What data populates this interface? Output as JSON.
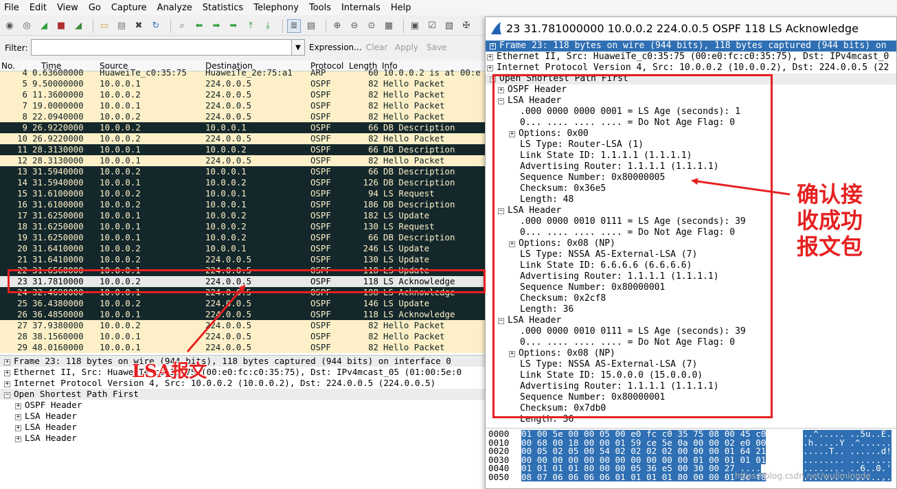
{
  "menubar": [
    "File",
    "Edit",
    "View",
    "Go",
    "Capture",
    "Analyze",
    "Statistics",
    "Telephony",
    "Tools",
    "Internals",
    "Help"
  ],
  "toolbar_icons": [
    "circle-icon",
    "record-icon",
    "shark-fin-icon",
    "stop-icon",
    "restart-icon",
    "open-icon",
    "save-icon",
    "close-icon",
    "reload-icon",
    "find-icon",
    "back-icon",
    "forward-icon",
    "goto-icon",
    "first-icon",
    "last-icon",
    "colorize-icon",
    "autoscroll-icon",
    "zoom-in-icon",
    "zoom-out-icon",
    "normal-size-icon",
    "resize-columns-icon",
    "capture-filters-icon",
    "display-filters-icon",
    "coloring-rules-icon",
    "preferences-icon"
  ],
  "filter": {
    "label": "Filter:",
    "value": "",
    "expression": "Expression...",
    "clear": "Clear",
    "apply": "Apply",
    "save": "Save"
  },
  "columns": [
    "No.",
    "Time",
    "Source",
    "Destination",
    "Protocol",
    "Length",
    "Info"
  ],
  "packets": [
    {
      "no": "4",
      "time": "0.63600000",
      "src": "HuaweiTe_c0:35:75",
      "dst": "HuaweiTe_2e:75:a1",
      "proto": "ARP",
      "len": "60",
      "info": "10.0.0.2 is at 00:e",
      "style": "hello"
    },
    {
      "no": "5",
      "time": "9.50000000",
      "src": "10.0.0.1",
      "dst": "224.0.0.5",
      "proto": "OSPF",
      "len": "82",
      "info": "Hello Packet",
      "style": "hello"
    },
    {
      "no": "6",
      "time": "11.3600000",
      "src": "10.0.0.2",
      "dst": "224.0.0.5",
      "proto": "OSPF",
      "len": "82",
      "info": "Hello Packet",
      "style": "hello"
    },
    {
      "no": "7",
      "time": "19.0000000",
      "src": "10.0.0.1",
      "dst": "224.0.0.5",
      "proto": "OSPF",
      "len": "82",
      "info": "Hello Packet",
      "style": "hello"
    },
    {
      "no": "8",
      "time": "22.0940000",
      "src": "10.0.0.2",
      "dst": "224.0.0.5",
      "proto": "OSPF",
      "len": "82",
      "info": "Hello Packet",
      "style": "hello"
    },
    {
      "no": "9",
      "time": "26.9220000",
      "src": "10.0.0.2",
      "dst": "10.0.0.1",
      "proto": "OSPF",
      "len": "66",
      "info": "DB Description",
      "style": "dark"
    },
    {
      "no": "10",
      "time": "26.9220000",
      "src": "10.0.0.2",
      "dst": "224.0.0.5",
      "proto": "OSPF",
      "len": "82",
      "info": "Hello Packet",
      "style": "hello"
    },
    {
      "no": "11",
      "time": "28.3130000",
      "src": "10.0.0.1",
      "dst": "10.0.0.2",
      "proto": "OSPF",
      "len": "66",
      "info": "DB Description",
      "style": "dark"
    },
    {
      "no": "12",
      "time": "28.3130000",
      "src": "10.0.0.1",
      "dst": "224.0.0.5",
      "proto": "OSPF",
      "len": "82",
      "info": "Hello Packet",
      "style": "hello"
    },
    {
      "no": "13",
      "time": "31.5940000",
      "src": "10.0.0.2",
      "dst": "10.0.0.1",
      "proto": "OSPF",
      "len": "66",
      "info": "DB Description",
      "style": "dark"
    },
    {
      "no": "14",
      "time": "31.5940000",
      "src": "10.0.0.1",
      "dst": "10.0.0.2",
      "proto": "OSPF",
      "len": "126",
      "info": "DB Description",
      "style": "dark"
    },
    {
      "no": "15",
      "time": "31.6100000",
      "src": "10.0.0.2",
      "dst": "10.0.0.1",
      "proto": "OSPF",
      "len": "94",
      "info": "LS Request",
      "style": "dark"
    },
    {
      "no": "16",
      "time": "31.6100000",
      "src": "10.0.0.2",
      "dst": "10.0.0.1",
      "proto": "OSPF",
      "len": "186",
      "info": "DB Description",
      "style": "dark"
    },
    {
      "no": "17",
      "time": "31.6250000",
      "src": "10.0.0.1",
      "dst": "10.0.0.2",
      "proto": "OSPF",
      "len": "182",
      "info": "LS Update",
      "style": "dark"
    },
    {
      "no": "18",
      "time": "31.6250000",
      "src": "10.0.0.1",
      "dst": "10.0.0.2",
      "proto": "OSPF",
      "len": "130",
      "info": "LS Request",
      "style": "dark"
    },
    {
      "no": "19",
      "time": "31.6250000",
      "src": "10.0.0.1",
      "dst": "10.0.0.2",
      "proto": "OSPF",
      "len": "66",
      "info": "DB Description",
      "style": "dark"
    },
    {
      "no": "20",
      "time": "31.6410000",
      "src": "10.0.0.2",
      "dst": "10.0.0.1",
      "proto": "OSPF",
      "len": "246",
      "info": "LS Update",
      "style": "dark"
    },
    {
      "no": "21",
      "time": "31.6410000",
      "src": "10.0.0.2",
      "dst": "224.0.0.5",
      "proto": "OSPF",
      "len": "130",
      "info": "LS Update",
      "style": "dark"
    },
    {
      "no": "22",
      "time": "31.6560000",
      "src": "10.0.0.1",
      "dst": "224.0.0.5",
      "proto": "OSPF",
      "len": "118",
      "info": "LS Update",
      "style": "dark"
    },
    {
      "no": "23",
      "time": "31.7810000",
      "src": "10.0.0.2",
      "dst": "224.0.0.5",
      "proto": "OSPF",
      "len": "118",
      "info": "LS Acknowledge",
      "style": "sel"
    },
    {
      "no": "24",
      "time": "32.4690000",
      "src": "10.0.0.1",
      "dst": "224.0.0.5",
      "proto": "OSPF",
      "len": "198",
      "info": "LS Acknowledge",
      "style": "dark"
    },
    {
      "no": "25",
      "time": "36.4380000",
      "src": "10.0.0.2",
      "dst": "224.0.0.5",
      "proto": "OSPF",
      "len": "146",
      "info": "LS Update",
      "style": "dark"
    },
    {
      "no": "26",
      "time": "36.4850000",
      "src": "10.0.0.1",
      "dst": "224.0.0.5",
      "proto": "OSPF",
      "len": "118",
      "info": "LS Acknowledge",
      "style": "dark"
    },
    {
      "no": "27",
      "time": "37.9380000",
      "src": "10.0.0.2",
      "dst": "224.0.0.5",
      "proto": "OSPF",
      "len": "82",
      "info": "Hello Packet",
      "style": "hello"
    },
    {
      "no": "28",
      "time": "38.1560000",
      "src": "10.0.0.1",
      "dst": "224.0.0.5",
      "proto": "OSPF",
      "len": "82",
      "info": "Hello Packet",
      "style": "hello"
    },
    {
      "no": "29",
      "time": "48.0160000",
      "src": "10.0.0.1",
      "dst": "224.0.0.5",
      "proto": "OSPF",
      "len": "82",
      "info": "Hello Packet",
      "style": "hello"
    }
  ],
  "details": [
    "Frame 23: 118 bytes on wire (944 bits), 118 bytes captured (944 bits) on interface 0",
    "Ethernet II, Src: HuaweiTe_c0:35:75 (00:e0:fc:c0:35:75), Dst: IPv4mcast_05 (01:00:5e:0",
    "Internet Protocol Version 4, Src: 10.0.0.2 (10.0.0.2), Dst: 224.0.0.5 (224.0.0.5)",
    "Open Shortest Path First",
    "OSPF Header",
    "LSA Header",
    "LSA Header",
    "LSA Header"
  ],
  "popup": {
    "title": "23 31.781000000 10.0.0.2 224.0.0.5 OSPF 118 LS Acknowledge",
    "lines": [
      "Frame 23: 118 bytes on wire (944 bits), 118 bytes captured (944 bits) on",
      "Ethernet II, Src: HuaweiTe_c0:35:75 (00:e0:fc:c0:35:75), Dst: IPv4mcast_0",
      "Internet Protocol Version 4, Src: 10.0.0.2 (10.0.0.2), Dst: 224.0.0.5 (22",
      "Open Shortest Path First",
      "OSPF Header",
      "LSA Header",
      ".000 0000 0000 0001 = LS Age (seconds): 1",
      "0... .... .... .... = Do Not Age Flag: 0",
      "Options: 0x00",
      "LS Type: Router-LSA (1)",
      "Link State ID: 1.1.1.1 (1.1.1.1)",
      "Advertising Router: 1.1.1.1 (1.1.1.1)",
      "Sequence Number: 0x80000005",
      "Checksum: 0x36e5",
      "Length: 48",
      "LSA Header",
      ".000 0000 0010 0111 = LS Age (seconds): 39",
      "0... .... .... .... = Do Not Age Flag: 0",
      "Options: 0x08 (NP)",
      "LS Type: NSSA AS-External-LSA (7)",
      "Link State ID: 6.6.6.6 (6.6.6.6)",
      "Advertising Router: 1.1.1.1 (1.1.1.1)",
      "Sequence Number: 0x80000001",
      "Checksum: 0x2cf8",
      "Length: 36",
      "LSA Header",
      ".000 0000 0010 0111 = LS Age (seconds): 39",
      "0... .... .... .... = Do Not Age Flag: 0",
      "Options: 0x08 (NP)",
      "LS Type: NSSA AS-External-LSA (7)",
      "Link State ID: 15.0.0.0 (15.0.0.0)",
      "Advertising Router: 1.1.1.1 (1.1.1.1)",
      "Sequence Number: 0x80000001",
      "Checksum: 0x7db0",
      "Length: 36"
    ],
    "hex": [
      {
        "off": "0000",
        "bytes": "01 00 5e 00 00 05 00 e0  fc c0 35 75 08 00 45 c0",
        "ascii": "..^..... ..5u..E."
      },
      {
        "off": "0010",
        "bytes": "00 68 00 18 00 00 01 59  ce 5e 0a 00 00 02 e0 00",
        "ascii": ".h.....Y .^......"
      },
      {
        "off": "0020",
        "bytes": "00 05 02 05 00 54 02 02  02 02 00 00 00 01 64 21",
        "ascii": ".....T.. ......d!"
      },
      {
        "off": "0030",
        "bytes": "00 00 00 00 00 00 00 00  00 00 00 01 00 01 01 01",
        "ascii": "........ ........"
      },
      {
        "off": "0040",
        "bytes": "01 01 01 01 80 00 00 05  36 e5 00 30 00 27 ....",
        "ascii": "........ ..6..0.'"
      },
      {
        "off": "0050",
        "bytes": "08 07 06 06 06 06 01 01  01 01 80 00 00 01 2c f8",
        "ascii": "........ ......,."
      }
    ]
  },
  "annotations": {
    "lsa_label": "LSA报文",
    "ack_label": [
      "确认接",
      "收成功",
      "报文包"
    ],
    "color": "#e62020"
  },
  "watermark": "https://blog.csdn.net/wulimingde"
}
